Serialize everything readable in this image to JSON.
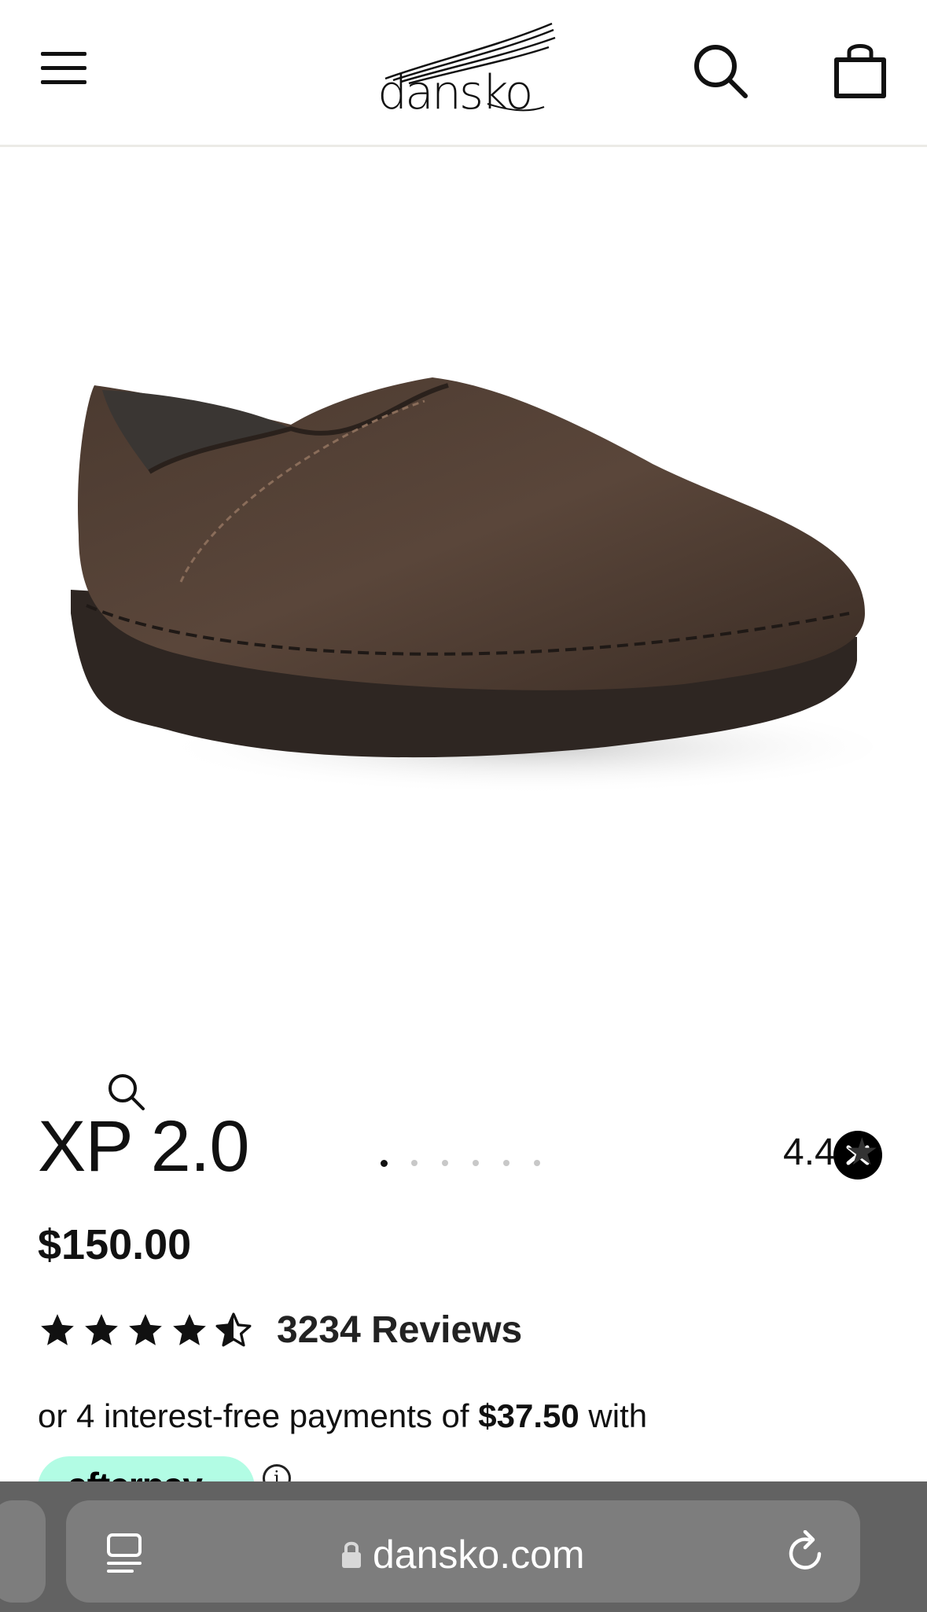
{
  "header": {
    "logo_text": "dansko",
    "menu_icon": "hamburger-icon",
    "search_icon": "search-icon",
    "cart_icon": "shopping-bag-icon"
  },
  "gallery": {
    "image": "brown leather clog shoe",
    "zoom_icon": "zoom-icon",
    "close_icon": "close-icon",
    "slide_count": 6,
    "active_slide": 1
  },
  "product": {
    "title": "XP 2.0",
    "rating_value": "4.4",
    "rating_star": "★",
    "price": "$150.00",
    "stars_filled": 4.5,
    "reviews_label": "3234 Reviews",
    "installments_prefix": "or 4 interest-free payments of ",
    "installments_amount": "$37.50",
    "installments_suffix": " with",
    "afterpay_label": "afterpay",
    "info_icon": "ⓘ"
  },
  "browser": {
    "url": "dansko.com",
    "reader_icon": "reader-icon",
    "lock_icon": "lock-icon",
    "reload_icon": "reload-icon"
  },
  "colors": {
    "afterpay": "#b2fce4",
    "browser_bar": "#626262",
    "url_bar": "#7d7d7d"
  }
}
